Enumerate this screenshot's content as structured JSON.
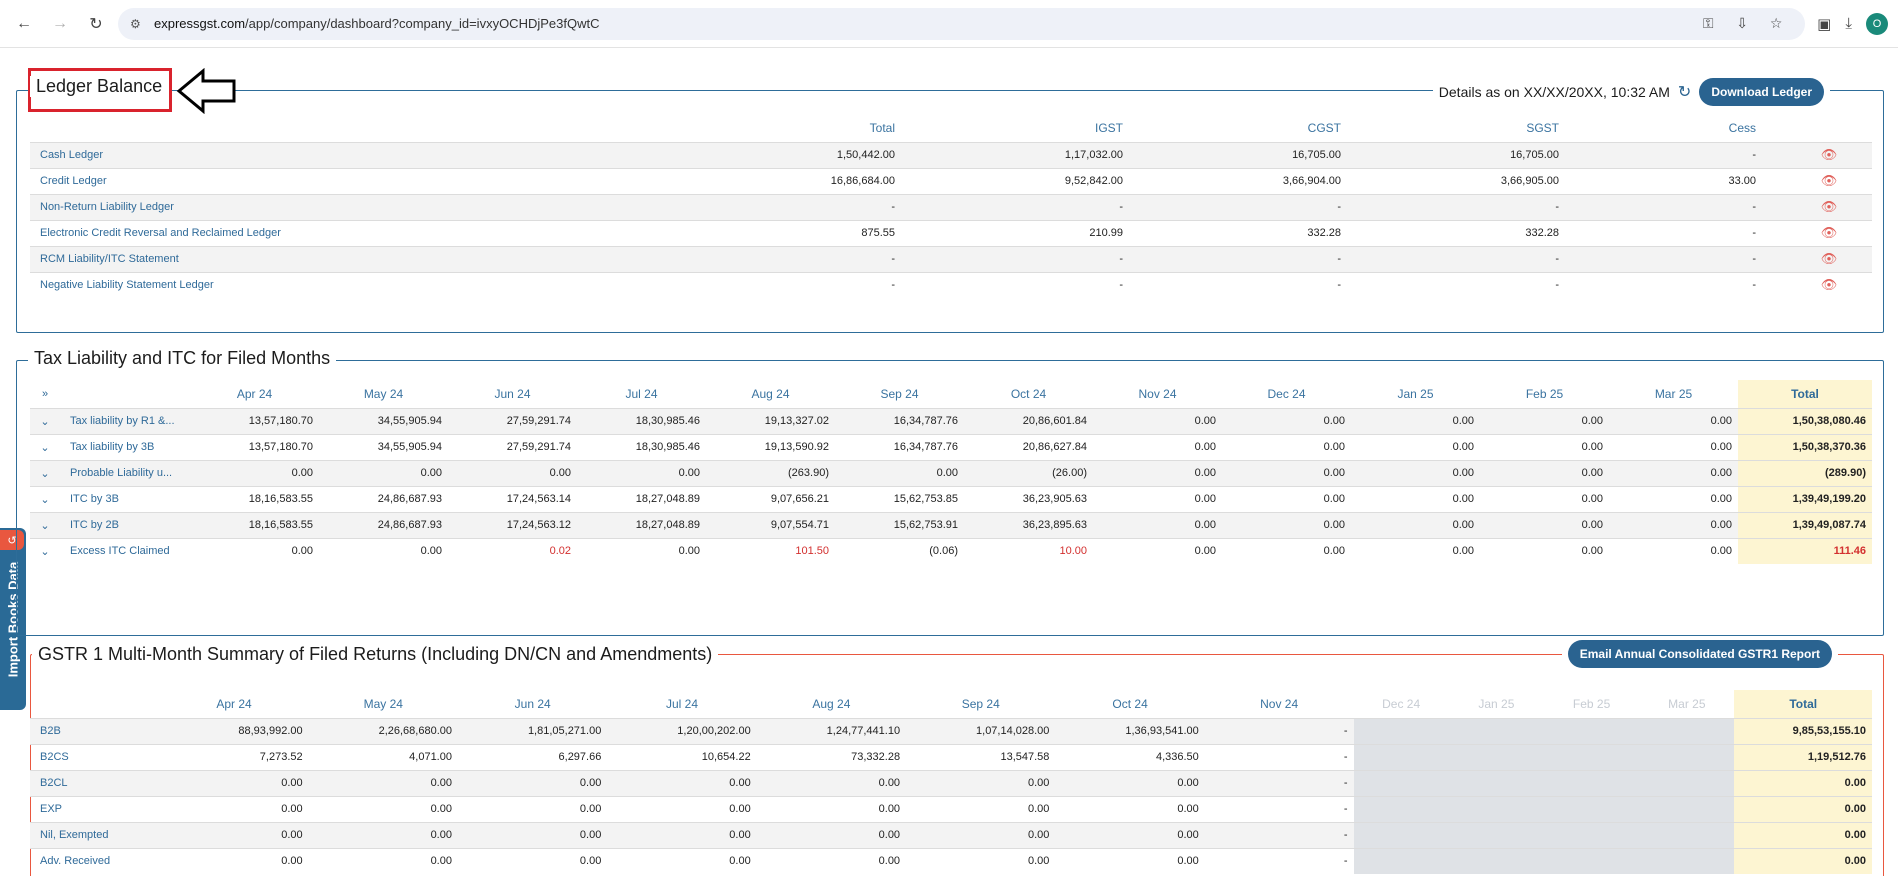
{
  "browser": {
    "url_host": "expressgst.com",
    "url_path": "/app/company/dashboard?company_id=ivxyOCHDjPe3fQwtC",
    "avatar_letter": "O"
  },
  "side_tab": {
    "label": "Import Books Data"
  },
  "ledger": {
    "title": "Ledger Balance",
    "details": "Details as on XX/XX/20XX, 10:32 AM",
    "download_label": "Download Ledger",
    "columns": [
      "Total",
      "IGST",
      "CGST",
      "SGST",
      "Cess"
    ],
    "rows": [
      {
        "label": "Cash Ledger",
        "values": [
          "1,50,442.00",
          "1,17,032.00",
          "16,705.00",
          "16,705.00",
          "-"
        ]
      },
      {
        "label": "Credit Ledger",
        "values": [
          "16,86,684.00",
          "9,52,842.00",
          "3,66,904.00",
          "3,66,905.00",
          "33.00"
        ]
      },
      {
        "label": "Non-Return Liability Ledger",
        "values": [
          "-",
          "-",
          "-",
          "-",
          "-"
        ]
      },
      {
        "label": "Electronic Credit Reversal and Reclaimed Ledger",
        "values": [
          "875.55",
          "210.99",
          "332.28",
          "332.28",
          "-"
        ]
      },
      {
        "label": "RCM Liability/ITC Statement",
        "values": [
          "-",
          "-",
          "-",
          "-",
          "-"
        ]
      },
      {
        "label": "Negative Liability Statement Ledger",
        "values": [
          "-",
          "-",
          "-",
          "-",
          "-"
        ]
      }
    ]
  },
  "tax": {
    "title": "Tax Liability and ITC for Filed Months",
    "months": [
      "Apr 24",
      "May 24",
      "Jun 24",
      "Jul 24",
      "Aug 24",
      "Sep 24",
      "Oct 24",
      "Nov 24",
      "Dec 24",
      "Jan 25",
      "Feb 25",
      "Mar 25"
    ],
    "total_label": "Total",
    "rows": [
      {
        "label": "Tax liability by R1 &...",
        "values": [
          "13,57,180.70",
          "34,55,905.94",
          "27,59,291.74",
          "18,30,985.46",
          "19,13,327.02",
          "16,34,787.76",
          "20,86,601.84",
          "0.00",
          "0.00",
          "0.00",
          "0.00",
          "0.00"
        ],
        "total": "1,50,38,080.46"
      },
      {
        "label": "Tax liability by 3B",
        "values": [
          "13,57,180.70",
          "34,55,905.94",
          "27,59,291.74",
          "18,30,985.46",
          "19,13,590.92",
          "16,34,787.76",
          "20,86,627.84",
          "0.00",
          "0.00",
          "0.00",
          "0.00",
          "0.00"
        ],
        "total": "1,50,38,370.36"
      },
      {
        "label": "Probable Liability u...",
        "values": [
          "0.00",
          "0.00",
          "0.00",
          "0.00",
          "(263.90)",
          "0.00",
          "(26.00)",
          "0.00",
          "0.00",
          "0.00",
          "0.00",
          "0.00"
        ],
        "total": "(289.90)"
      },
      {
        "label": "ITC by 3B",
        "values": [
          "18,16,583.55",
          "24,86,687.93",
          "17,24,563.14",
          "18,27,048.89",
          "9,07,656.21",
          "15,62,753.85",
          "36,23,905.63",
          "0.00",
          "0.00",
          "0.00",
          "0.00",
          "0.00"
        ],
        "total": "1,39,49,199.20"
      },
      {
        "label": "ITC by 2B",
        "values": [
          "18,16,583.55",
          "24,86,687.93",
          "17,24,563.12",
          "18,27,048.89",
          "9,07,554.71",
          "15,62,753.91",
          "36,23,895.63",
          "0.00",
          "0.00",
          "0.00",
          "0.00",
          "0.00"
        ],
        "total": "1,39,49,087.74"
      },
      {
        "label": "Excess ITC Claimed",
        "values": [
          "0.00",
          "0.00",
          "0.02",
          "0.00",
          "101.50",
          "(0.06)",
          "10.00",
          "0.00",
          "0.00",
          "0.00",
          "0.00",
          "0.00"
        ],
        "total": "111.46",
        "red": [
          2,
          4,
          6
        ],
        "total_red": true
      }
    ]
  },
  "gstr1": {
    "title": "GSTR 1 Multi-Month Summary of Filed Returns (Including DN/CN and Amendments)",
    "email_label": "Email Annual Consolidated GSTR1 Report",
    "months": [
      "Apr 24",
      "May 24",
      "Jun 24",
      "Jul 24",
      "Aug 24",
      "Sep 24",
      "Oct 24",
      "Nov 24",
      "Dec 24",
      "Jan 25",
      "Feb 25",
      "Mar 25"
    ],
    "total_label": "Total",
    "rows": [
      {
        "label": "B2B",
        "values": [
          "88,93,992.00",
          "2,26,68,680.00",
          "1,81,05,271.00",
          "1,20,00,202.00",
          "1,24,77,441.10",
          "1,07,14,028.00",
          "1,36,93,541.00",
          "-"
        ],
        "total": "9,85,53,155.10"
      },
      {
        "label": "B2CS",
        "values": [
          "7,273.52",
          "4,071.00",
          "6,297.66",
          "10,654.22",
          "73,332.28",
          "13,547.58",
          "4,336.50",
          "-"
        ],
        "total": "1,19,512.76"
      },
      {
        "label": "B2CL",
        "values": [
          "0.00",
          "0.00",
          "0.00",
          "0.00",
          "0.00",
          "0.00",
          "0.00",
          "-"
        ],
        "total": "0.00"
      },
      {
        "label": "EXP",
        "values": [
          "0.00",
          "0.00",
          "0.00",
          "0.00",
          "0.00",
          "0.00",
          "0.00",
          "-"
        ],
        "total": "0.00"
      },
      {
        "label": "Nil, Exempted",
        "values": [
          "0.00",
          "0.00",
          "0.00",
          "0.00",
          "0.00",
          "0.00",
          "0.00",
          "-"
        ],
        "total": "0.00"
      },
      {
        "label": "Adv. Received",
        "values": [
          "0.00",
          "0.00",
          "0.00",
          "0.00",
          "0.00",
          "0.00",
          "0.00",
          "-"
        ],
        "total": "0.00"
      }
    ]
  }
}
